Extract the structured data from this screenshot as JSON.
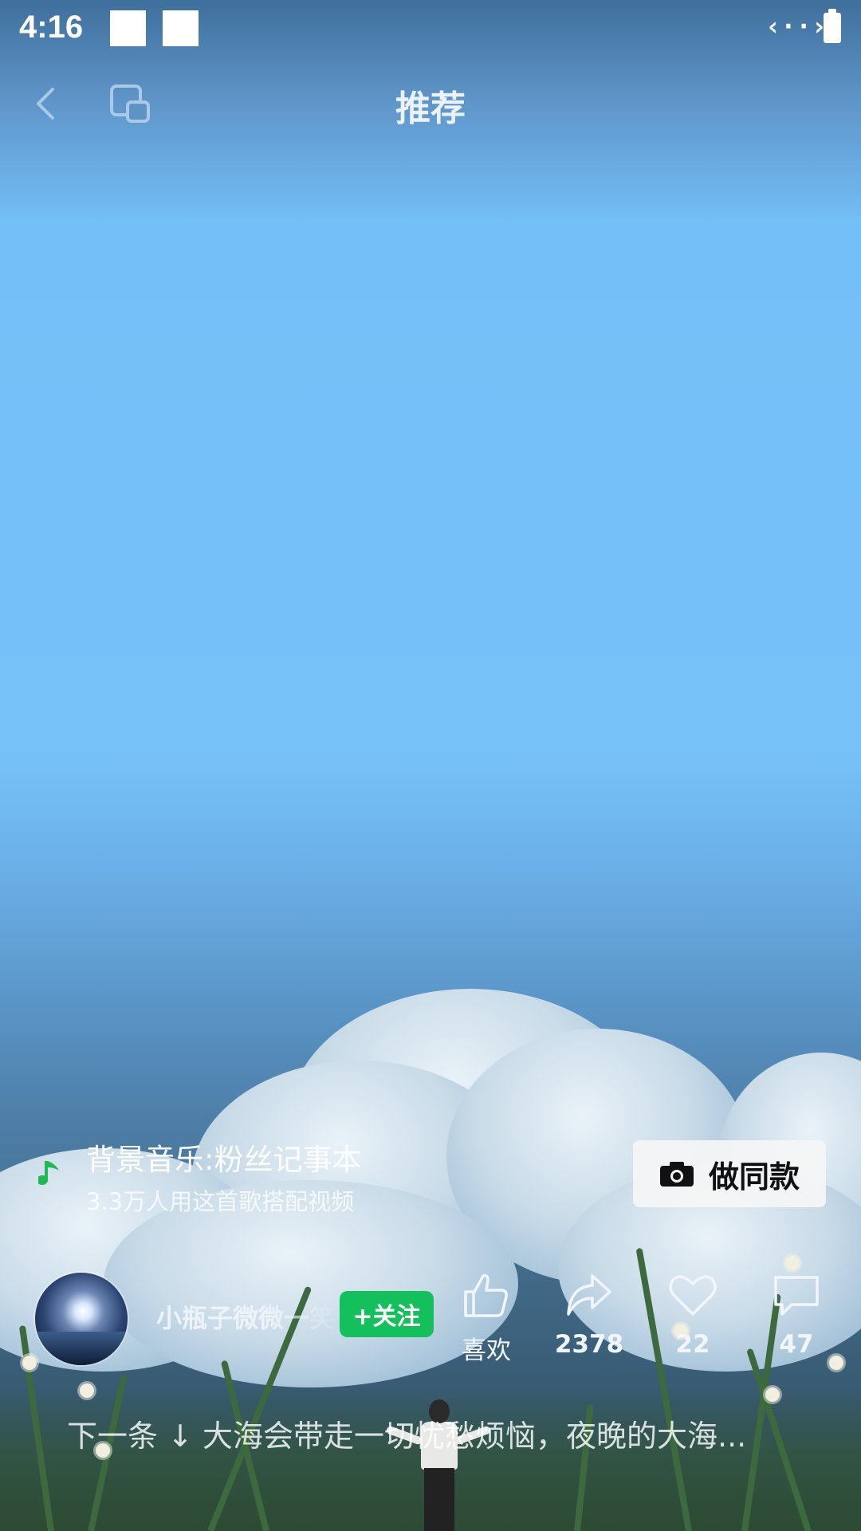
{
  "status_bar": {
    "time": "4:16",
    "icons": [
      "notification-square",
      "notification-square",
      "link-icon",
      "battery-icon"
    ]
  },
  "top_bar": {
    "title": "推荐",
    "back_icon": "chevron-left-icon",
    "switch_icon": "screen-switch-icon"
  },
  "music": {
    "icon": "music-note-icon",
    "title": "背景音乐:粉丝记事本",
    "usage": "3.3万人用这首歌搭配视频"
  },
  "make_same": {
    "icon": "camera-icon",
    "label": "做同款"
  },
  "author": {
    "name": "小瓶子微微一笑",
    "follow_label": "+关注"
  },
  "actions": {
    "like": {
      "icon": "thumbs-up-icon",
      "label": "喜欢"
    },
    "share": {
      "icon": "share-arrow-icon",
      "count": "2378"
    },
    "favorite": {
      "icon": "heart-icon",
      "count": "22"
    },
    "comment": {
      "icon": "comment-bubble-icon",
      "count": "47"
    }
  },
  "next": {
    "text": "下一条 ↓ 大海会带走一切忧愁烦恼，夜晚的大海..."
  },
  "colors": {
    "follow_green": "#14c05b",
    "music_note_green": "#1db954",
    "sky_blue": "#76c1f8"
  }
}
